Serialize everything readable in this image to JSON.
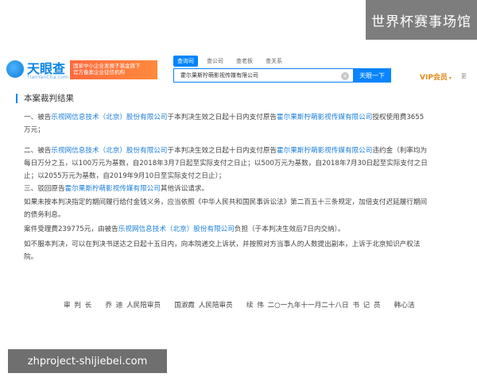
{
  "overlay": {
    "site_banner": "世界杯赛事场馆",
    "url_banner": "zhproject-shijiebei.com"
  },
  "header": {
    "logo_text": "天眼查",
    "logo_sub": "TianYanCha.com",
    "promo_line1": "国家中小企业发展子基金旗下",
    "promo_line2": "官方备案企业征信机构",
    "tabs": [
      "查询司",
      "查公司",
      "查老板",
      "查关系"
    ],
    "search_value": "霍尔果斯柠萌影视传媒有限公司",
    "clear_glyph": "×",
    "search_button": "天眼一下",
    "vip_label": "VIP会员",
    "vip_arrow": "▾",
    "more_label": "更"
  },
  "content": {
    "section_title": "本案裁判结果",
    "p1": {
      "a": "一、被告",
      "link1": "乐视网信息技术（北京）股份有限公司",
      "b": "于本判决生效之日起十日内支付原告",
      "link2": "霍尔果斯柠萌影视传媒有限公司",
      "c": "授权使用费3655",
      "d": "万元；"
    },
    "p2": {
      "a": "二、被告",
      "link1": "乐视网信息技术（北京）股份有限公司",
      "b": "于本判决生效之日起十日内支付原告",
      "link2": "霍尔果斯柠萌影视传媒有限公司",
      "c": "违约金（利率均为",
      "d": "每日万分之五，以100万元为基数，自2018年3月7日起至实际支付之日止；以500万元为基数，自2018年7月30日起至实际支付之日",
      "e": "止；以2055万元为基数，自2019年9月10日至实际支付之日止）；"
    },
    "p3": {
      "a": "三、驳回原告",
      "link": "霍尔果斯柠萌影视传媒有限公司",
      "b": "其他诉讼请求。"
    },
    "p4": {
      "a": "如果未按本判决指定的期间履行给付金钱义务，应当依照《中华人民共和国民事诉讼法》第二百五十三条规定，加倍支付迟延履行期间",
      "b": "的债务利息。"
    },
    "p5": {
      "a": "案件受理费239775元，由被告",
      "link": "乐视网信息技术（北京）股份有限公司",
      "b": "负担（于本判决生效后7日内交纳）。"
    },
    "p6": {
      "a": "如不服本判决，可以在判决书送达之日起十五日内，向本院递交上诉状，并按照对方当事人的人数提出副本，上诉于北京知识产权法",
      "b": "院。"
    },
    "signature": "审 判 长　　乔 迪 人民陪审员　　国淑霞 人民陪审员　　续 伟 二○一九年十一月二十八日 书 记 员　　韩心洁"
  }
}
